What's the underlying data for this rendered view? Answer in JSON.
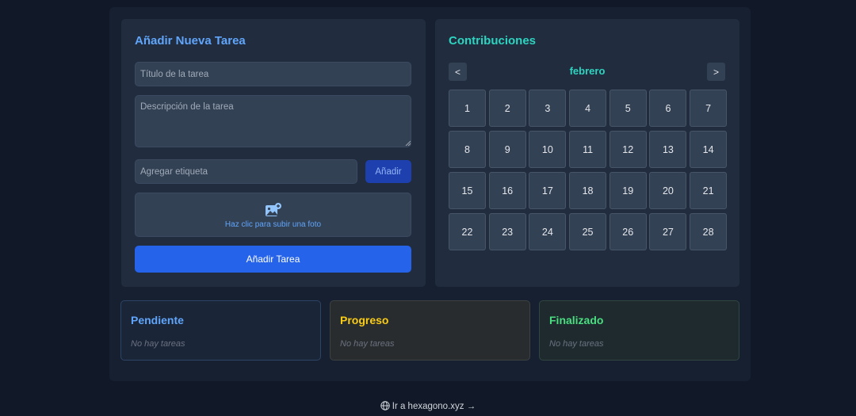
{
  "form": {
    "title": "Añadir Nueva Tarea",
    "title_placeholder": "Título de la tarea",
    "description_placeholder": "Descripción de la tarea",
    "tag_placeholder": "Agregar etiqueta",
    "add_tag_label": "Añadir",
    "upload_label": "Haz clic para subir una foto",
    "upload_icon": "image-plus-icon",
    "submit_label": "Añadir Tarea"
  },
  "calendar": {
    "title": "Contribuciones",
    "month": "febrero",
    "prev_label": "<",
    "next_label": ">",
    "days": [
      "1",
      "2",
      "3",
      "4",
      "5",
      "6",
      "7",
      "8",
      "9",
      "10",
      "11",
      "12",
      "13",
      "14",
      "15",
      "16",
      "17",
      "18",
      "19",
      "20",
      "21",
      "22",
      "23",
      "24",
      "25",
      "26",
      "27",
      "28"
    ]
  },
  "columns": [
    {
      "title": "Pendiente",
      "empty": "No hay tareas",
      "color": "#60a5fa"
    },
    {
      "title": "Progreso",
      "empty": "No hay tareas",
      "color": "#facc15"
    },
    {
      "title": "Finalizado",
      "empty": "No hay tareas",
      "color": "#4ade80"
    }
  ],
  "footer": {
    "link_label": "Ir a hexagono.xyz →",
    "icon": "globe-icon"
  }
}
